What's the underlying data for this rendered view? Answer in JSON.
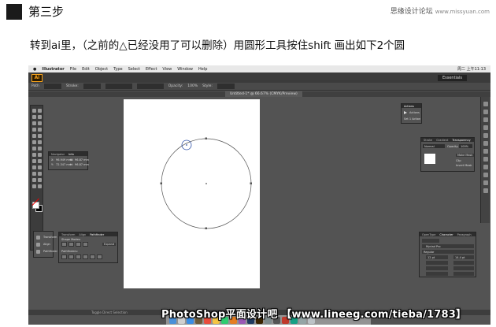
{
  "header": {
    "step_title": "第三步",
    "watermark_cn": "思缘设计论坛",
    "watermark_site": "www.missyuan.com"
  },
  "instruction": "转到ai里，（之前的△已经没用了可以删除）用圆形工具按住shift 画出如下2个圆",
  "screenshot": {
    "mac_menu": [
      "Illustrator",
      "File",
      "Edit",
      "Object",
      "Type",
      "Select",
      "Effect",
      "View",
      "Window",
      "Help"
    ],
    "mac_menu_right": "周二 上午11:13",
    "app_name": "Ai",
    "workspace": "Essentials",
    "control_bar": {
      "label": "Path",
      "stroke_label": "Stroke:",
      "opacity_label": "Opacity:",
      "opacity_value": "100%",
      "style_label": "Style:"
    },
    "document_tab": "Untitled-1* @ 66.67% (CMYK/Preview)",
    "panels": {
      "navigator": {
        "tabs": [
          "Navigator",
          "Info"
        ],
        "x_label": "X:",
        "x_value": "96.949 mm",
        "y_label": "Y:",
        "y_value": "72.347 mm",
        "w_label": "W:",
        "w_value": "96.87 mm",
        "h_label": "H:",
        "h_value": "96.87 mm"
      },
      "actions": {
        "tabs": [
          "Actions"
        ],
        "items": [
          "Actions",
          "Set 1 Action"
        ]
      },
      "stroke": {
        "tabs": [
          "Stroke",
          "Gradient",
          "Transparency"
        ],
        "mode": "Normal",
        "opacity_label": "Opacity:",
        "opacity_value": "100%",
        "make_mask": "Make Mask",
        "clip": "Clip",
        "invert": "Invert Mask"
      },
      "layers_mini": {
        "items": [
          "Transform",
          "Align",
          "Pathfinder"
        ]
      },
      "pathfinder": {
        "tabs": [
          "Transform",
          "Align",
          "Pathfinder"
        ],
        "shape_modes": "Shape Modes:",
        "pathfinders": "Pathfinders:",
        "expand": "Expand"
      },
      "character": {
        "tabs": [
          "OpenType",
          "Character",
          "Paragraph"
        ],
        "font": "Myriad Pro",
        "style": "Regular",
        "size": "12 pt",
        "leading": "14.4 pt"
      }
    },
    "status_bar": "Toggle Direct Selection"
  },
  "footer_watermark": "PhotoShop平面设计吧 【www.lineeg.com/tieba/1783】"
}
